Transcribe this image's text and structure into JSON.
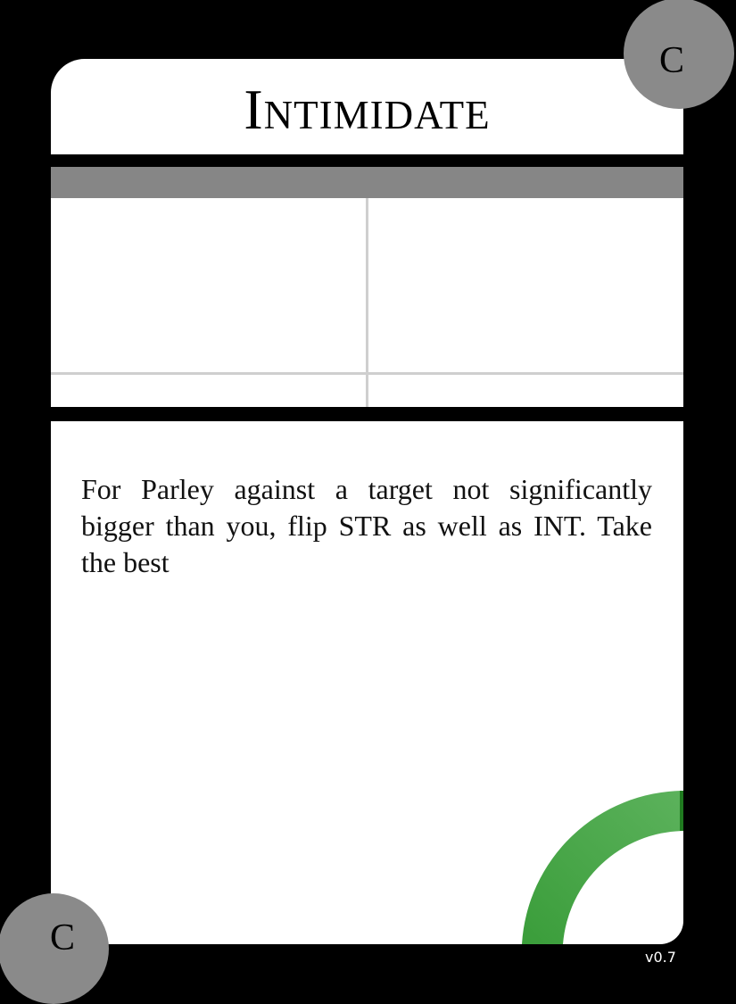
{
  "card": {
    "title": "Intimidate",
    "rank_top": "C",
    "rank_bottom": "C",
    "rules_text": "For Parley against a target not significantly bigger than you, flip STR as well as INT. Take the best",
    "version": "v0.7"
  },
  "stats": {
    "top_left": "",
    "top_right": "",
    "bottom_left": "",
    "bottom_right": ""
  },
  "colors": {
    "background": "#000000",
    "panel": "#ffffff",
    "header_bar": "#868686",
    "rank_circle": "#8a8a8a",
    "arc_green": "#3fa23f"
  }
}
